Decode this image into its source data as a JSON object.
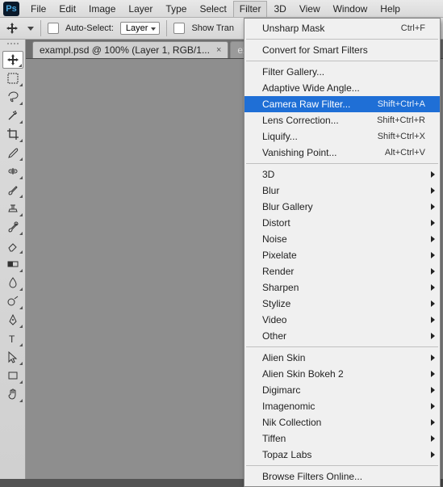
{
  "menubar": [
    "File",
    "Edit",
    "Image",
    "Layer",
    "Type",
    "Select",
    "Filter",
    "3D",
    "View",
    "Window",
    "Help"
  ],
  "menubar_open_index": 6,
  "options": {
    "auto_select": "Auto-Select:",
    "layer": "Layer",
    "show_transform": "Show Tran"
  },
  "tabs": {
    "active": "exampl.psd @ 100% (Layer 1, RGB/1...",
    "inactive": "exa"
  },
  "dropdown": {
    "section1": [
      {
        "label": "Unsharp Mask",
        "shortcut": "Ctrl+F"
      }
    ],
    "section2": [
      {
        "label": "Convert for Smart Filters"
      }
    ],
    "section3": [
      {
        "label": "Filter Gallery..."
      },
      {
        "label": "Adaptive Wide Angle..."
      },
      {
        "label": "Camera Raw Filter...",
        "shortcut": "Shift+Ctrl+A",
        "highlight": true
      },
      {
        "label": "Lens Correction...",
        "shortcut": "Shift+Ctrl+R"
      },
      {
        "label": "Liquify...",
        "shortcut": "Shift+Ctrl+X"
      },
      {
        "label": "Vanishing Point...",
        "shortcut": "Alt+Ctrl+V"
      }
    ],
    "section4": [
      {
        "label": "3D",
        "arrow": true
      },
      {
        "label": "Blur",
        "arrow": true
      },
      {
        "label": "Blur Gallery",
        "arrow": true
      },
      {
        "label": "Distort",
        "arrow": true
      },
      {
        "label": "Noise",
        "arrow": true
      },
      {
        "label": "Pixelate",
        "arrow": true
      },
      {
        "label": "Render",
        "arrow": true
      },
      {
        "label": "Sharpen",
        "arrow": true
      },
      {
        "label": "Stylize",
        "arrow": true
      },
      {
        "label": "Video",
        "arrow": true
      },
      {
        "label": "Other",
        "arrow": true
      }
    ],
    "section5": [
      {
        "label": "Alien Skin",
        "arrow": true
      },
      {
        "label": "Alien Skin Bokeh 2",
        "arrow": true
      },
      {
        "label": "Digimarc",
        "arrow": true
      },
      {
        "label": "Imagenomic",
        "arrow": true
      },
      {
        "label": "Nik Collection",
        "arrow": true
      },
      {
        "label": "Tiffen",
        "arrow": true
      },
      {
        "label": "Topaz Labs",
        "arrow": true
      }
    ],
    "section6": [
      {
        "label": "Browse Filters Online..."
      }
    ]
  },
  "logo": "Ps"
}
